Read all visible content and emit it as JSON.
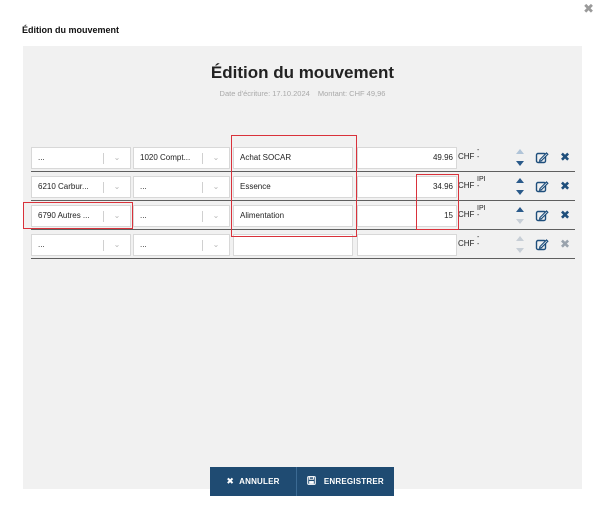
{
  "window": {
    "title": "Édition du mouvement",
    "close_icon": "close-icon"
  },
  "panel": {
    "heading": "Édition du mouvement",
    "date_text": "Date d'écriture: 17.10.2024",
    "amount_text": "Montant: CHF 49,96"
  },
  "rows": [
    {
      "account1": "...",
      "account2": "1020 Compt...",
      "label": "Achat SOCAR",
      "amount": "49.96",
      "currency": "CHF",
      "cur_top": "-",
      "cur_bot": "-"
    },
    {
      "account1": "6210 Carbur...",
      "account2": "...",
      "label": "Essence",
      "amount": "34.96",
      "currency": "CHF",
      "cur_top": "IPI",
      "cur_bot": "-"
    },
    {
      "account1": "6790 Autres ...",
      "account2": "...",
      "label": "Alimentation",
      "amount": "15",
      "currency": "CHF",
      "cur_top": "IPI",
      "cur_bot": "-"
    },
    {
      "account1": "...",
      "account2": "...",
      "label": "",
      "amount": "",
      "currency": "CHF",
      "cur_top": "-",
      "cur_bot": "-"
    }
  ],
  "actions": {
    "cancel_label": "ANNULER",
    "save_label": "ENREGISTRER"
  },
  "colors": {
    "primary": "#1f4b72",
    "highlight": "#d9323b",
    "panel_bg": "#f1f1f1"
  }
}
